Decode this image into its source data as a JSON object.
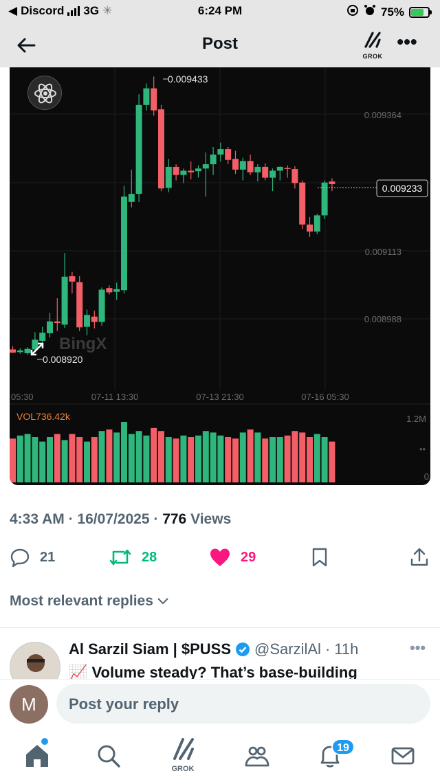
{
  "status_bar": {
    "back_app": "Discord",
    "network": "3G",
    "time": "6:24 PM",
    "battery": "75%",
    "battery_level": 0.75
  },
  "header": {
    "title": "Post",
    "grok_label": "GROK",
    "more": "•••"
  },
  "chart_data": {
    "type": "candlestick",
    "watermark": "BingX",
    "yticks": [
      "0.009364",
      "0.009113",
      "0.008988"
    ],
    "last_price": "0.009233",
    "high_label": "0.009433",
    "low_label": "0.008920",
    "xticks": [
      "05:30",
      "07-11 13:30",
      "07-13 21:30",
      "07-16 05:30"
    ],
    "volume_label": "VOL736.42k",
    "volume_axis": "1.2M",
    "volume_axis_zero": "0",
    "ylim": [
      0.00885,
      0.00945
    ],
    "candles": [
      {
        "o": 0.008926,
        "h": 0.008932,
        "l": 0.008919,
        "c": 0.00892
      },
      {
        "o": 0.008921,
        "h": 0.008928,
        "l": 0.008918,
        "c": 0.008924
      },
      {
        "o": 0.008919,
        "h": 0.00893,
        "l": 0.008916,
        "c": 0.008927
      },
      {
        "o": 0.008926,
        "h": 0.008958,
        "l": 0.00892,
        "c": 0.008944
      },
      {
        "o": 0.008942,
        "h": 0.008968,
        "l": 0.008935,
        "c": 0.008957
      },
      {
        "o": 0.008956,
        "h": 0.008994,
        "l": 0.008948,
        "c": 0.008978
      },
      {
        "o": 0.008978,
        "h": 0.009021,
        "l": 0.00896,
        "c": 0.008975
      },
      {
        "o": 0.008972,
        "h": 0.009105,
        "l": 0.008966,
        "c": 0.009061
      },
      {
        "o": 0.009062,
        "h": 0.00907,
        "l": 0.00903,
        "c": 0.009052
      },
      {
        "o": 0.009051,
        "h": 0.009062,
        "l": 0.00896,
        "c": 0.008967
      },
      {
        "o": 0.008968,
        "h": 0.009,
        "l": 0.008952,
        "c": 0.00899
      },
      {
        "o": 0.008987,
        "h": 0.008998,
        "l": 0.008965,
        "c": 0.008977
      },
      {
        "o": 0.008977,
        "h": 0.009041,
        "l": 0.00897,
        "c": 0.009037
      },
      {
        "o": 0.00904,
        "h": 0.009045,
        "l": 0.009028,
        "c": 0.009032
      },
      {
        "o": 0.009033,
        "h": 0.00905,
        "l": 0.009018,
        "c": 0.009038
      },
      {
        "o": 0.009036,
        "h": 0.00923,
        "l": 0.00903,
        "c": 0.00921
      },
      {
        "o": 0.0092,
        "h": 0.00926,
        "l": 0.00919,
        "c": 0.009215
      },
      {
        "o": 0.009215,
        "h": 0.0094,
        "l": 0.0092,
        "c": 0.00938
      },
      {
        "o": 0.00938,
        "h": 0.00942,
        "l": 0.00937,
        "c": 0.009411
      },
      {
        "o": 0.009411,
        "h": 0.009433,
        "l": 0.00936,
        "c": 0.00937
      },
      {
        "o": 0.009372,
        "h": 0.00938,
        "l": 0.00922,
        "c": 0.009225
      },
      {
        "o": 0.009226,
        "h": 0.00928,
        "l": 0.009218,
        "c": 0.009265
      },
      {
        "o": 0.009265,
        "h": 0.00927,
        "l": 0.00924,
        "c": 0.00925
      },
      {
        "o": 0.00925,
        "h": 0.009262,
        "l": 0.009235,
        "c": 0.009258
      },
      {
        "o": 0.009258,
        "h": 0.009275,
        "l": 0.009242,
        "c": 0.009255
      },
      {
        "o": 0.009257,
        "h": 0.009268,
        "l": 0.009245,
        "c": 0.009262
      },
      {
        "o": 0.009262,
        "h": 0.009292,
        "l": 0.00921,
        "c": 0.00927
      },
      {
        "o": 0.00927,
        "h": 0.009302,
        "l": 0.00925,
        "c": 0.009288
      },
      {
        "o": 0.009288,
        "h": 0.00931,
        "l": 0.009275,
        "c": 0.009298
      },
      {
        "o": 0.009298,
        "h": 0.009302,
        "l": 0.00927,
        "c": 0.009278
      },
      {
        "o": 0.00928,
        "h": 0.009295,
        "l": 0.009252,
        "c": 0.00926
      },
      {
        "o": 0.00926,
        "h": 0.009282,
        "l": 0.00924,
        "c": 0.009276
      },
      {
        "o": 0.009276,
        "h": 0.009288,
        "l": 0.00925,
        "c": 0.009255
      },
      {
        "o": 0.009255,
        "h": 0.00927,
        "l": 0.009238,
        "c": 0.009265
      },
      {
        "o": 0.009265,
        "h": 0.009272,
        "l": 0.00924,
        "c": 0.009245
      },
      {
        "o": 0.009245,
        "h": 0.009262,
        "l": 0.00922,
        "c": 0.009258
      },
      {
        "o": 0.009258,
        "h": 0.009266,
        "l": 0.00924,
        "c": 0.009265
      },
      {
        "o": 0.009263,
        "h": 0.009268,
        "l": 0.009245,
        "c": 0.009262
      },
      {
        "o": 0.009261,
        "h": 0.009266,
        "l": 0.009225,
        "c": 0.009235
      },
      {
        "o": 0.009236,
        "h": 0.00924,
        "l": 0.00915,
        "c": 0.009158
      },
      {
        "o": 0.009158,
        "h": 0.009172,
        "l": 0.009135,
        "c": 0.009145
      },
      {
        "o": 0.009145,
        "h": 0.009178,
        "l": 0.00914,
        "c": 0.009175
      },
      {
        "o": 0.009175,
        "h": 0.00924,
        "l": 0.009168,
        "c": 0.009236
      },
      {
        "o": 0.009238,
        "h": 0.009244,
        "l": 0.00922,
        "c": 0.009233
      }
    ],
    "volumes": [
      0.58,
      0.62,
      0.64,
      0.6,
      0.54,
      0.6,
      0.64,
      0.56,
      0.64,
      0.6,
      0.54,
      0.6,
      0.68,
      0.7,
      0.66,
      0.8,
      0.64,
      0.68,
      0.62,
      0.72,
      0.68,
      0.6,
      0.58,
      0.62,
      0.6,
      0.62,
      0.68,
      0.66,
      0.62,
      0.6,
      0.58,
      0.66,
      0.7,
      0.66,
      0.58,
      0.6,
      0.6,
      0.62,
      0.68,
      0.66,
      0.6,
      0.64,
      0.6,
      0.54
    ]
  },
  "post_meta": {
    "time": "4:33 AM",
    "date": "16/07/2025",
    "views_count": "776",
    "views_label": "Views"
  },
  "actions": {
    "replies": "21",
    "reposts": "28",
    "likes": "29"
  },
  "sort_label": "Most relevant replies",
  "reply": {
    "name": "Al Sarzil Siam | $PUSS",
    "handle": "@SarzilAl",
    "age": "11h",
    "text": "📈 Volume steady? That’s base-building"
  },
  "composer": {
    "avatar_letter": "M",
    "placeholder": "Post your reply"
  },
  "nav": {
    "grok_label": "GROK",
    "notifications_badge": "19"
  },
  "colors": {
    "up": "#2eb67d",
    "down": "#f25f67",
    "like": "#f91880",
    "repost": "#00ba7c",
    "accent": "#1d9bf0"
  }
}
